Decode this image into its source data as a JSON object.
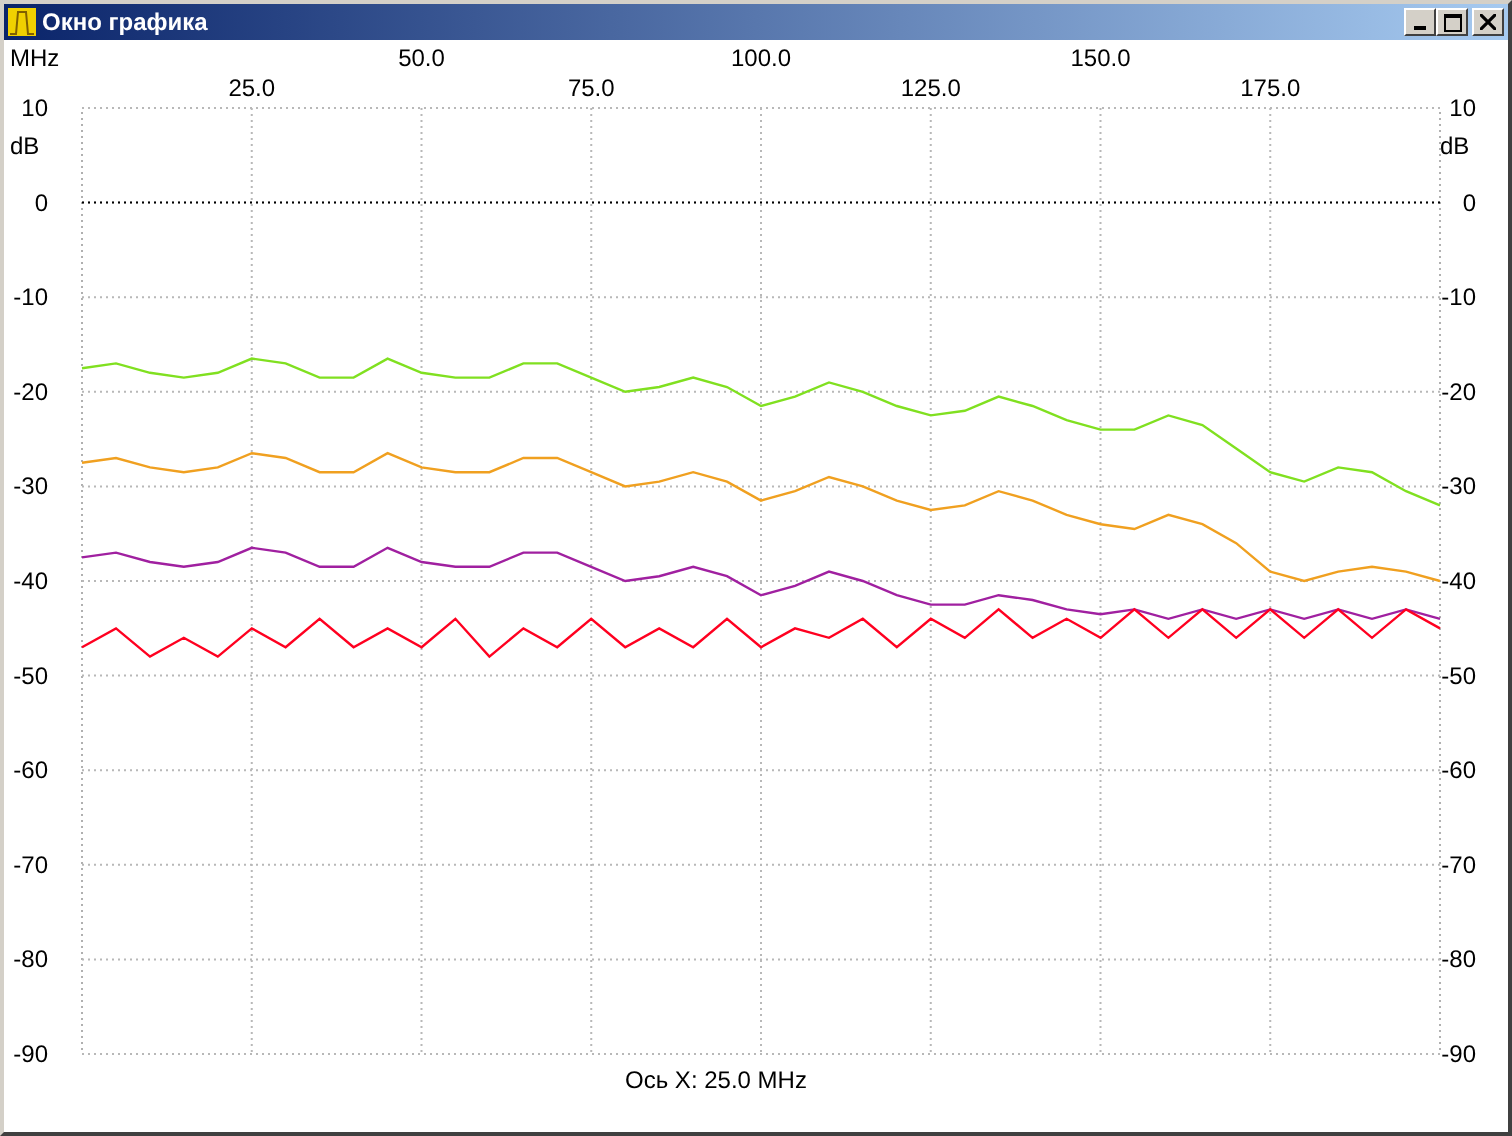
{
  "window": {
    "title": "Окно графика"
  },
  "chart": {
    "x_unit": "MHz",
    "y_unit_left": "dB",
    "y_unit_right": "dB",
    "upper_x_labels": [
      "50.0",
      "100.0",
      "150.0"
    ],
    "left_y_labels": [
      "10",
      "0",
      "-10",
      "-20",
      "-30",
      "-40",
      "-50",
      "-60",
      "-70",
      "-80",
      "-90"
    ],
    "chart_data": {
      "type": "line",
      "x": [
        0,
        5,
        10,
        15,
        20,
        25,
        30,
        35,
        40,
        45,
        50,
        55,
        60,
        65,
        70,
        75,
        80,
        85,
        90,
        95,
        100,
        105,
        110,
        115,
        120,
        125,
        130,
        135,
        140,
        145,
        150,
        155,
        160,
        165,
        170,
        175,
        180,
        185,
        190,
        195,
        200
      ],
      "series": [
        {
          "color": "#80e020",
          "values": [
            -17.5,
            -17,
            -18,
            -18.5,
            -18,
            -16.5,
            -17,
            -18.5,
            -18.5,
            -16.5,
            -18,
            -18.5,
            -18.5,
            -17,
            -17,
            -18.5,
            -20,
            -19.5,
            -18.5,
            -19.5,
            -21.5,
            -20.5,
            -19,
            -20,
            -21.5,
            -22.5,
            -22,
            -20.5,
            -21.5,
            -23,
            -24,
            -24,
            -22.5,
            -23.5,
            -26,
            -28.5,
            -29.5,
            -28,
            -28.5,
            -30.5,
            -32
          ]
        },
        {
          "color": "#f0a020",
          "values": [
            -27.5,
            -27,
            -28,
            -28.5,
            -28,
            -26.5,
            -27,
            -28.5,
            -28.5,
            -26.5,
            -28,
            -28.5,
            -28.5,
            -27,
            -27,
            -28.5,
            -30,
            -29.5,
            -28.5,
            -29.5,
            -31.5,
            -30.5,
            -29,
            -30,
            -31.5,
            -32.5,
            -32,
            -30.5,
            -31.5,
            -33,
            -34,
            -34.5,
            -33,
            -34,
            -36,
            -39,
            -40,
            -39,
            -38.5,
            -39,
            -40
          ]
        },
        {
          "color": "#a020a0",
          "values": [
            -37.5,
            -37,
            -38,
            -38.5,
            -38,
            -36.5,
            -37,
            -38.5,
            -38.5,
            -36.5,
            -38,
            -38.5,
            -38.5,
            -37,
            -37,
            -38.5,
            -40,
            -39.5,
            -38.5,
            -39.5,
            -41.5,
            -40.5,
            -39,
            -40,
            -41.5,
            -42.5,
            -42.5,
            -41.5,
            -42,
            -43,
            -43.5,
            -43,
            -44,
            -43,
            -44,
            -43,
            -44,
            -43,
            -44,
            -43,
            -44
          ]
        },
        {
          "color": "#ff0020",
          "values": [
            -47,
            -45,
            -48,
            -46,
            -48,
            -45,
            -47,
            -44,
            -47,
            -45,
            -47,
            -44,
            -48,
            -45,
            -47,
            -44,
            -47,
            -45,
            -47,
            -44,
            -47,
            -45,
            -46,
            -44,
            -47,
            -44,
            -46,
            -43,
            -46,
            -44,
            -46,
            -43,
            -46,
            -43,
            -46,
            -43,
            -46,
            -43,
            -46,
            -43,
            -45
          ]
        }
      ],
      "xlim": [
        0,
        200
      ],
      "ylim": [
        -90,
        10
      ],
      "grid": true,
      "ref_lines": [
        {
          "axis": "y",
          "value": 0
        }
      ],
      "xticks": [
        {
          "value": 25,
          "label": "25.0"
        },
        {
          "value": 75,
          "label": "75.0"
        },
        {
          "value": 125,
          "label": "125.0"
        },
        {
          "value": 175,
          "label": "175.0"
        }
      ],
      "yticks": [
        10,
        0,
        -10,
        -20,
        -30,
        -40,
        -50,
        -60,
        -70,
        -80,
        -90
      ]
    }
  },
  "cursor_readout": "Ось X: 25.0 MHz"
}
